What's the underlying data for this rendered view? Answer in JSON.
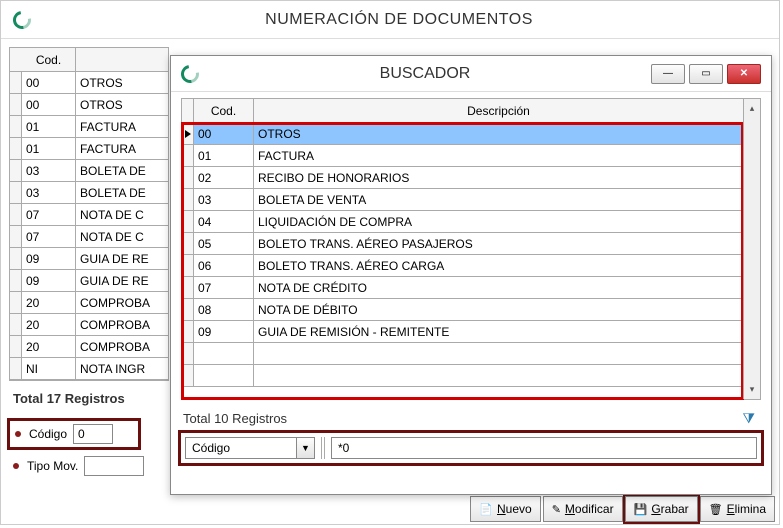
{
  "main": {
    "title": "NUMERACIÓN DE DOCUMENTOS",
    "table": {
      "header_cod": "Cod.",
      "rows": [
        {
          "cod": "00",
          "desc": "OTROS"
        },
        {
          "cod": "00",
          "desc": "OTROS"
        },
        {
          "cod": "01",
          "desc": "FACTURA"
        },
        {
          "cod": "01",
          "desc": "FACTURA"
        },
        {
          "cod": "03",
          "desc": "BOLETA DE"
        },
        {
          "cod": "03",
          "desc": "BOLETA DE"
        },
        {
          "cod": "07",
          "desc": "NOTA DE C"
        },
        {
          "cod": "07",
          "desc": "NOTA DE C"
        },
        {
          "cod": "09",
          "desc": "GUIA DE RE"
        },
        {
          "cod": "09",
          "desc": "GUIA DE RE"
        },
        {
          "cod": "20",
          "desc": "COMPROBA"
        },
        {
          "cod": "20",
          "desc": "COMPROBA"
        },
        {
          "cod": "20",
          "desc": "COMPROBA"
        },
        {
          "cod": "NI",
          "desc": "NOTA INGR"
        }
      ],
      "total": "Total 17 Registros"
    },
    "fields": {
      "codigo_label": "Código",
      "codigo_value": "0",
      "tipomov_label": "Tipo Mov.",
      "tipomov_value": ""
    }
  },
  "dialog": {
    "title": "BUSCADOR",
    "table": {
      "header_cod": "Cod.",
      "header_desc": "Descripción",
      "rows": [
        {
          "cod": "00",
          "desc": "OTROS"
        },
        {
          "cod": "01",
          "desc": "FACTURA"
        },
        {
          "cod": "02",
          "desc": "RECIBO DE HONORARIOS"
        },
        {
          "cod": "03",
          "desc": "BOLETA DE VENTA"
        },
        {
          "cod": "04",
          "desc": "LIQUIDACIÓN DE COMPRA"
        },
        {
          "cod": "05",
          "desc": "BOLETO TRANS. AÉREO PASAJEROS"
        },
        {
          "cod": "06",
          "desc": "BOLETO TRANS. AÉREO CARGA"
        },
        {
          "cod": "07",
          "desc": "NOTA DE CRÉDITO"
        },
        {
          "cod": "08",
          "desc": "NOTA DE DÉBITO"
        },
        {
          "cod": "09",
          "desc": "GUIA DE REMISIÓN - REMITENTE"
        }
      ],
      "selected_index": 0,
      "total": "Total 10 Registros"
    },
    "filter": {
      "dropdown": "Código",
      "value": "*0"
    }
  },
  "toolbar": {
    "nuevo": "Nuevo",
    "modificar": "Modificar",
    "grabar": "Grabar",
    "elimina": "Elimina"
  }
}
